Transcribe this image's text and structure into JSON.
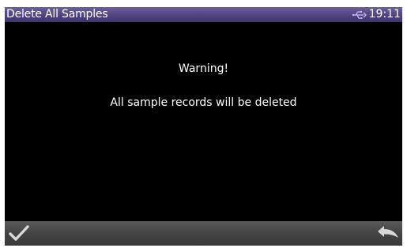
{
  "window": {
    "title": "Delete All Samples"
  },
  "status": {
    "usb_icon": "usb-icon",
    "time": "19:11"
  },
  "dialog": {
    "heading": "Warning!",
    "message": "All sample records will be deleted"
  },
  "footer": {
    "confirm_icon": "checkmark-icon",
    "back_icon": "back-arrow-icon"
  },
  "colors": {
    "title_bar": "#4f4381",
    "background": "#000000",
    "footer": "#444444",
    "text": "#ffffff"
  }
}
